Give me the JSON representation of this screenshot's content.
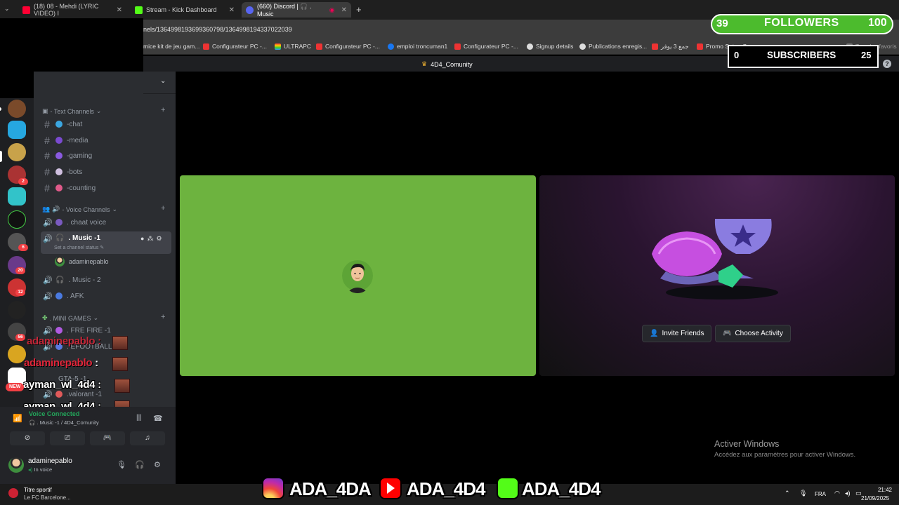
{
  "browser": {
    "tabs": [
      {
        "label": "(18) 08 - Mehdi (LYRIC VIDEO) I",
        "favicon_color": "#ff0033"
      },
      {
        "label": "Stream - Kick Dashboard",
        "favicon_color": "#53fc18"
      },
      {
        "label": "(660) Discord | 🎧 . Music",
        "favicon_color": "#5865f2"
      }
    ],
    "new_tab": "+",
    "url": "nels/1364998193699360798/1364998194337022039",
    "bookmarks": [
      "mice kit de jeu gam...",
      "Configurateur PC -...",
      "ULTRAPC",
      "Configurateur PC -...",
      "emploi troncuman1",
      "Configurateur PC -...",
      "Signup details",
      "Publications enregis...",
      "جمع 3 يوفر",
      "Promo Setup Game...",
      "Tous les favoris"
    ]
  },
  "discord": {
    "server_title": "4D4_Comunity",
    "help": "?",
    "categories": {
      "text": "- Text Channels",
      "voice": "- Voice Channels",
      "games": ". MINI GAMES"
    },
    "text_channels": [
      "-chat",
      "-media",
      "-gaming",
      "-bots",
      "-counting"
    ],
    "voice_channels": [
      ". chaat voice",
      ". Music -1",
      ". Music - 2",
      ". AFK"
    ],
    "channel_status": "Set a channel status",
    "voice_member": "adaminepablo",
    "game_channels": [
      ". FRE FIRE -1",
      ". EFOOTBALL -1",
      "GTA-5 -1",
      ".valorant -1"
    ],
    "voice_panel": {
      "status": "Voice Connected",
      "location": "🎧 . Music -1 / 4D4_Comunity"
    },
    "user": {
      "name": "adaminepablo",
      "status": "In voice"
    },
    "new_badge": "NEW",
    "server_badges": [
      "2",
      "6",
      "20",
      "12",
      "56"
    ],
    "actions": {
      "invite": "Invite Friends",
      "activity": "Choose Activity"
    }
  },
  "chat_overlay": [
    {
      "user": "adaminepablo",
      "sep": ":"
    },
    {
      "user": "adaminepablo",
      "sep": ":"
    },
    {
      "user": "ayman_wl_4d4",
      "sep": ":"
    },
    {
      "user": "ayman_wl_4d4",
      "sep": ":"
    }
  ],
  "stream": {
    "followers_count": "39",
    "followers_label": "FOLLOWERS",
    "followers_goal": "100",
    "subs_count": "0",
    "subs_label": "SUBSCRIBERS",
    "subs_goal": "25",
    "socials": [
      "ADA_4DA",
      "ADA_4D4",
      "ADA_4D4"
    ]
  },
  "windows": {
    "activate_title": "Activer Windows",
    "activate_sub": "Accédez aux paramètres pour activer Windows."
  },
  "taskbar": {
    "weather_title": "Titre sportif",
    "weather_sub": "Le FC Barcelone...",
    "language": "FRA",
    "time": "21:42",
    "date": "21/09/2025"
  }
}
